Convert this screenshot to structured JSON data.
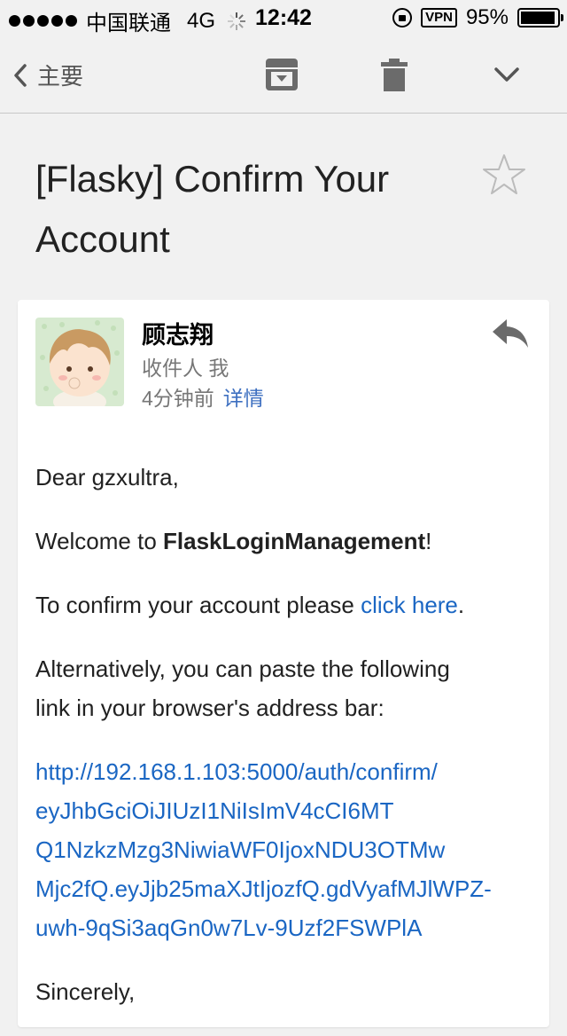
{
  "status_bar": {
    "carrier": "中国联通",
    "network": "4G",
    "time": "12:42",
    "vpn": "VPN",
    "battery": "95%",
    "battery_level": 0.95
  },
  "toolbar": {
    "back_label": "主要",
    "icons": [
      "back-chevron-icon",
      "archive-icon",
      "trash-icon",
      "chevron-down-icon"
    ]
  },
  "email": {
    "subject_line1": "[Flasky] Confirm Your",
    "subject_line2": "Account",
    "sender": "顾志翔",
    "recipient": "收件人 我",
    "time": "4分钟前",
    "details": "详情",
    "body": {
      "greeting": "Dear gzxultra,",
      "welcome_prefix": "Welcome to ",
      "app_name": "FlaskLoginManagement",
      "welcome_suffix": "!",
      "confirm_prefix": "To confirm your account please ",
      "confirm_link": "click here",
      "confirm_suffix": ".",
      "alt_line1": "Alternatively, you can paste the following",
      "alt_line2": "link in your browser's address bar:",
      "url_lines": [
        "http://192.168.1.103:5000/auth/confirm/",
        "eyJhbGciOiJIUzI1NiIsImV4cCI6MT",
        "Q1NzkzMzg3NiwiaWF0IjoxNDU3OTMw",
        "Mjc2fQ.eyJjb25maXJtIjozfQ.gdVyafMJlWPZ-",
        "uwh-9qSi3aqGn0w7Lv-9Uzf2FSWPlA"
      ],
      "closing": "Sincerely,"
    }
  },
  "colors": {
    "link": "#1a66c3",
    "details": "#3d6fc0",
    "background": "#f1f1f1"
  }
}
